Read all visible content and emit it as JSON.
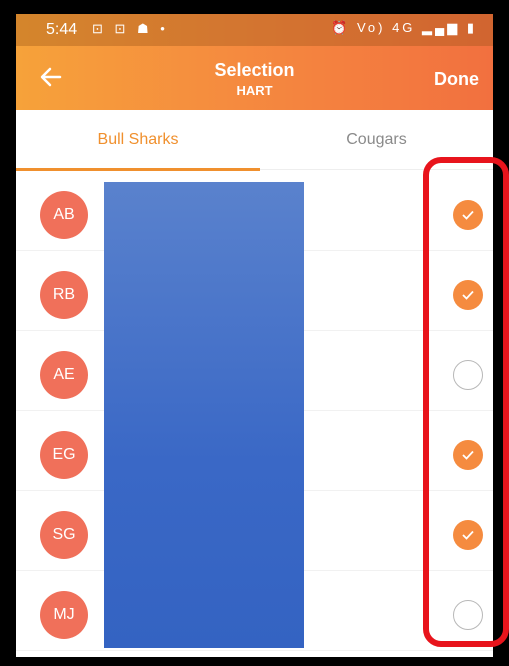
{
  "status_bar": {
    "time": "5:44",
    "left_icons": "⊡ ⊡ ☗ •",
    "right_icons": "⏰ Vo) 4G ▂▄▆ ▮"
  },
  "header": {
    "title": "Selection",
    "subtitle": "HART",
    "done_label": "Done"
  },
  "tabs": [
    {
      "label": "Bull Sharks",
      "active": true
    },
    {
      "label": "Cougars",
      "active": false
    }
  ],
  "players": [
    {
      "initials": "AB",
      "selected": true
    },
    {
      "initials": "RB",
      "selected": true
    },
    {
      "initials": "AE",
      "selected": false
    },
    {
      "initials": "EG",
      "selected": true
    },
    {
      "initials": "SG",
      "selected": true
    },
    {
      "initials": "MJ",
      "selected": false
    }
  ],
  "colors": {
    "accent": "#f58b3f",
    "avatar": "#f0705a",
    "highlight": "#e8141c",
    "redaction": "#3a68c6"
  }
}
